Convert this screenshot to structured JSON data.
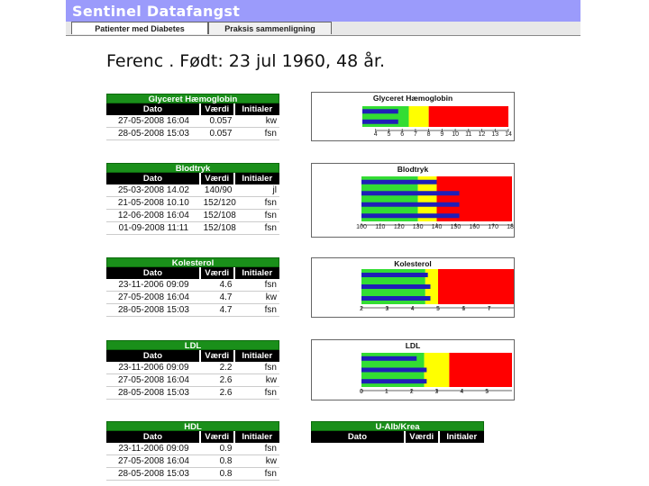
{
  "app": {
    "title": "Sentinel Datafangst"
  },
  "tabs": [
    {
      "label": "Patienter med Diabetes",
      "active": true
    },
    {
      "label": "Praksis sammenligning",
      "active": false
    }
  ],
  "patient": {
    "heading": "Ferenc . Født: 23 jul 1960, 48 år."
  },
  "colors": {
    "green": "#33dd33",
    "yellow": "#ffff00",
    "red": "#ff0000",
    "bar": "#1f1fb8",
    "header": "#9b9bfb",
    "table_title": "#1a8f1a"
  },
  "tables": [
    {
      "id": "hba1c",
      "title": "Glyceret Hæmoglobin",
      "columns": [
        "Dato",
        "Værdi",
        "Initialer"
      ],
      "rows": [
        [
          "27-05-2008 16:04",
          "0.057",
          "kw"
        ],
        [
          "28-05-2008 15:03",
          "0.057",
          "fsn"
        ]
      ]
    },
    {
      "id": "bp",
      "title": "Blodtryk",
      "columns": [
        "Dato",
        "Værdi",
        "Initialer"
      ],
      "rows": [
        [
          "25-03-2008 14.02",
          "140/90",
          "jl"
        ],
        [
          "21-05-2008 10.10",
          "152/120",
          "fsn"
        ],
        [
          "12-06-2008 16:04",
          "152/108",
          "fsn"
        ],
        [
          "01-09-2008 11:11",
          "152/108",
          "fsn"
        ]
      ]
    },
    {
      "id": "chol",
      "title": "Kolesterol",
      "columns": [
        "Dato",
        "Værdi",
        "Initialer"
      ],
      "rows": [
        [
          "23-11-2006 09:09",
          "4.6",
          "fsn"
        ],
        [
          "27-05-2008 16:04",
          "4.7",
          "kw"
        ],
        [
          "28-05-2008 15:03",
          "4.7",
          "fsn"
        ]
      ]
    },
    {
      "id": "ldl",
      "title": "LDL",
      "columns": [
        "Dato",
        "Værdi",
        "Initialer"
      ],
      "rows": [
        [
          "23-11-2006 09:09",
          "2.2",
          "fsn"
        ],
        [
          "27-05-2008 16:04",
          "2.6",
          "kw"
        ],
        [
          "28-05-2008 15:03",
          "2.6",
          "fsn"
        ]
      ]
    },
    {
      "id": "hdl",
      "title": "HDL",
      "columns": [
        "Dato",
        "Værdi",
        "Initialer"
      ],
      "rows": [
        [
          "23-11-2006 09:09",
          "0.9",
          "fsn"
        ],
        [
          "27-05-2008 16:04",
          "0.8",
          "kw"
        ],
        [
          "28-05-2008 15:03",
          "0.8",
          "fsn"
        ]
      ]
    },
    {
      "id": "ualb",
      "title": "U-Alb/Krea",
      "columns": [
        "Dato",
        "Værdi",
        "Initialer"
      ],
      "rows": []
    }
  ],
  "chart_data": [
    {
      "type": "bar",
      "orientation": "horizontal",
      "title": "Glyceret Hæmoglobin",
      "xlim": [
        3,
        14
      ],
      "ticks": [
        4,
        5,
        6,
        7,
        8,
        9,
        10,
        11,
        12,
        13,
        14
      ],
      "zones": [
        {
          "from": 3,
          "to": 6.5,
          "color": "#33dd33"
        },
        {
          "from": 6.5,
          "to": 8,
          "color": "#ffff00"
        },
        {
          "from": 8,
          "to": 14,
          "color": "#ff0000"
        }
      ],
      "values": [
        5.7,
        5.7
      ]
    },
    {
      "type": "bar",
      "orientation": "horizontal",
      "title": "Blodtryk",
      "xlim": [
        100,
        180
      ],
      "ticks": [
        100,
        110,
        120,
        130,
        140,
        150,
        160,
        170,
        180
      ],
      "zones": [
        {
          "from": 100,
          "to": 130,
          "color": "#33dd33"
        },
        {
          "from": 130,
          "to": 140,
          "color": "#ffff00"
        },
        {
          "from": 140,
          "to": 180,
          "color": "#ff0000"
        }
      ],
      "values": [
        140,
        152,
        152,
        152
      ]
    },
    {
      "type": "bar",
      "orientation": "horizontal",
      "title": "Kolesterol",
      "xlim": [
        2,
        8
      ],
      "ticks": [
        2,
        3,
        4,
        5,
        6,
        7
      ],
      "zones": [
        {
          "from": 2,
          "to": 4.5,
          "color": "#33dd33"
        },
        {
          "from": 4.5,
          "to": 5,
          "color": "#ffff00"
        },
        {
          "from": 5,
          "to": 8,
          "color": "#ff0000"
        }
      ],
      "values": [
        4.6,
        4.7,
        4.7
      ]
    },
    {
      "type": "bar",
      "orientation": "horizontal",
      "title": "LDL",
      "xlim": [
        0,
        6
      ],
      "ticks": [
        0,
        1,
        2,
        3,
        4,
        5
      ],
      "zones": [
        {
          "from": 0,
          "to": 2.5,
          "color": "#33dd33"
        },
        {
          "from": 2.5,
          "to": 3.5,
          "color": "#ffff00"
        },
        {
          "from": 3.5,
          "to": 6,
          "color": "#ff0000"
        }
      ],
      "values": [
        2.2,
        2.6,
        2.6
      ]
    }
  ]
}
